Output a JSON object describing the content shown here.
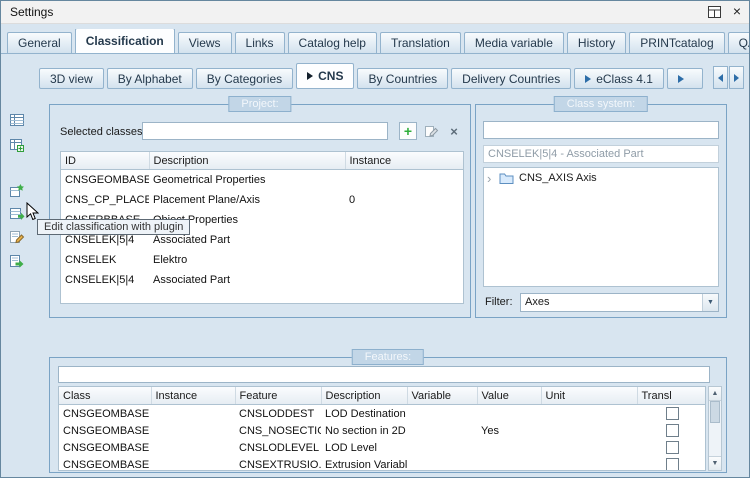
{
  "window": {
    "title": "Settings"
  },
  "icons": {
    "close": "×",
    "add": "+",
    "clear": "×",
    "dropdown": "▼",
    "scroll_up": "▲",
    "scroll_down": "▼",
    "tree_expander": "›"
  },
  "tabs": {
    "main": [
      {
        "label": "General",
        "active": false
      },
      {
        "label": "Classification",
        "active": true
      },
      {
        "label": "Views",
        "active": false
      },
      {
        "label": "Links",
        "active": false
      },
      {
        "label": "Catalog help",
        "active": false
      },
      {
        "label": "Translation",
        "active": false
      },
      {
        "label": "Media variable",
        "active": false
      },
      {
        "label": "History",
        "active": false
      },
      {
        "label": "PRINTcatalog",
        "active": false
      },
      {
        "label": "QA",
        "active": false
      }
    ],
    "sub": [
      {
        "label": "3D view",
        "active": false
      },
      {
        "label": "By Alphabet",
        "active": false
      },
      {
        "label": "By Categories",
        "active": false
      },
      {
        "label": "CNS",
        "active": true
      },
      {
        "label": "By Countries",
        "active": false
      },
      {
        "label": "Delivery Countries",
        "active": false
      },
      {
        "label": "eClass 4.1",
        "active": false
      }
    ]
  },
  "toolbar": {
    "tooltip": "Edit classification with plugin",
    "icon_names": [
      "classification-table-icon",
      "classification-table-add-icon",
      "plugin-icon",
      "edit-classification-plugin-icon",
      "edit-list-icon",
      "export-plugin-icon"
    ]
  },
  "project": {
    "group_label": "Project:",
    "selected_classes_label": "Selected classes",
    "selected_classes_value": "",
    "table": {
      "headers": [
        "ID",
        "Description",
        "Instance"
      ],
      "rows": [
        [
          "CNSGEOMBASE",
          "Geometrical Properties",
          ""
        ],
        [
          "CNS_CP_PLACE...",
          "Placement Plane/Axis",
          "0"
        ],
        [
          "CNSERBBASE",
          "Object Properties",
          ""
        ],
        [
          "CNSELEK|5|4",
          "Associated Part",
          ""
        ],
        [
          "CNSELEK",
          "Elektro",
          ""
        ],
        [
          "CNSELEK|5|4",
          "Associated Part",
          ""
        ]
      ]
    }
  },
  "class_system": {
    "group_label": "Class system:",
    "search_value": "",
    "selected_class": "CNSELEK|5|4 - Associated Part",
    "tree": [
      {
        "label": "CNS_AXIS Axis"
      }
    ],
    "filter_label": "Filter:",
    "filter_value": "Axes"
  },
  "features": {
    "group_label": "Features:",
    "search_value": "",
    "table": {
      "headers": [
        "Class",
        "Instance",
        "Feature",
        "Description",
        "Variable",
        "Value",
        "Unit",
        "Transl"
      ],
      "rows": [
        {
          "class": "CNSGEOMBASE",
          "instance": "",
          "feature": "CNSLODDEST",
          "description": "LOD Destination",
          "variable": "",
          "value": "",
          "unit": "",
          "transl_checked": false
        },
        {
          "class": "CNSGEOMBASE",
          "instance": "",
          "feature": "CNS_NOSECTION",
          "description": "No section in 2D",
          "variable": "",
          "value": "Yes",
          "unit": "",
          "transl_checked": false
        },
        {
          "class": "CNSGEOMBASE",
          "instance": "",
          "feature": "CNSLODLEVEL",
          "description": "LOD Level",
          "variable": "",
          "value": "",
          "unit": "",
          "transl_checked": false
        },
        {
          "class": "CNSGEOMBASE",
          "instance": "",
          "feature": "CNSEXTRUSIO...",
          "description": "Extrusion Variable",
          "variable": "",
          "value": "",
          "unit": "",
          "transl_checked": false
        }
      ]
    }
  },
  "colors": {
    "accent_border": "#7aa3c5",
    "tab_border": "#93b3cd",
    "green": "#3fae49",
    "panel_bg": "#d8e5f0"
  }
}
